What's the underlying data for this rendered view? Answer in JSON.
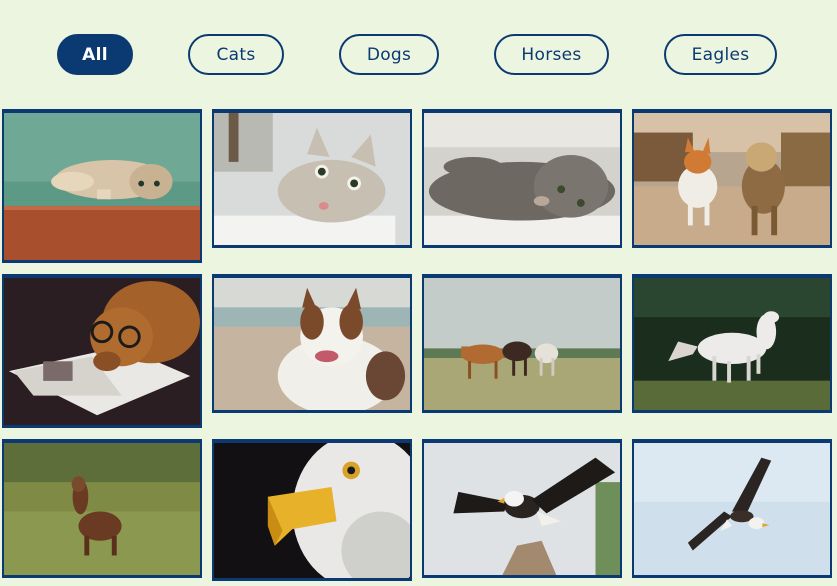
{
  "filters": [
    {
      "label": "All",
      "active": true
    },
    {
      "label": "Cats",
      "active": false
    },
    {
      "label": "Dogs",
      "active": false
    },
    {
      "label": "Horses",
      "active": false
    },
    {
      "label": "Eagles",
      "active": false
    }
  ],
  "gallery": {
    "items": [
      {
        "subject": "cat",
        "depiction": "tabby cat lying on wooden floor"
      },
      {
        "subject": "cat",
        "depiction": "wide-eyed cat peeking over ledge"
      },
      {
        "subject": "cat",
        "depiction": "gray tabby cat lying on its side"
      },
      {
        "subject": "dog",
        "depiction": "corgi and yorkie walking on path"
      },
      {
        "subject": "dog",
        "depiction": "dog with glasses reading magazine"
      },
      {
        "subject": "dog",
        "depiction": "brown and white dog at beach"
      },
      {
        "subject": "horse",
        "depiction": "three horses in a field"
      },
      {
        "subject": "horse",
        "depiction": "white horse running"
      },
      {
        "subject": "horse",
        "depiction": "brown foal in grass"
      },
      {
        "subject": "eagle",
        "depiction": "bald eagle head close-up"
      },
      {
        "subject": "eagle",
        "depiction": "bald eagle landing on rock"
      },
      {
        "subject": "eagle",
        "depiction": "bald eagle in flight"
      }
    ]
  },
  "colors": {
    "background": "#ecf5df",
    "accent": "#0b3a72"
  }
}
